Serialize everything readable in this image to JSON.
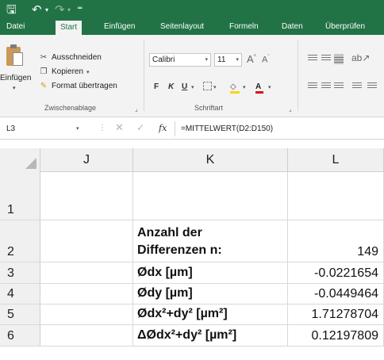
{
  "quick_access": {
    "save_icon": "save-icon",
    "undo_icon": "undo-icon",
    "redo_icon": "redo-icon",
    "customize_icon": "customize-qat-icon"
  },
  "ribbon_tabs": [
    {
      "label": "Datei"
    },
    {
      "label": "Start"
    },
    {
      "label": "Einfügen"
    },
    {
      "label": "Seitenlayout"
    },
    {
      "label": "Formeln"
    },
    {
      "label": "Daten"
    },
    {
      "label": "Überprüfen"
    }
  ],
  "ribbon": {
    "clipboard": {
      "paste_label": "Einfügen",
      "cut_label": "Ausschneiden",
      "copy_label": "Kopieren",
      "format_painter_label": "Format übertragen",
      "group_label": "Zwischenablage"
    },
    "font": {
      "font_name": "Calibri",
      "font_size": "11",
      "bold_label": "F",
      "italic_label": "K",
      "underline_label": "U",
      "fill_color": "#f5d60a",
      "font_color": "#e01010",
      "font_color_label": "A",
      "group_label": "Schriftart"
    }
  },
  "formula_bar": {
    "name_box": "L3",
    "function_label": "fx",
    "formula": "=MITTELWERT(D2:D150)"
  },
  "columns": [
    "J",
    "K",
    "L"
  ],
  "rows": [
    {
      "number": "1",
      "label_line1": "",
      "label_line2": "",
      "value": ""
    },
    {
      "number": "2",
      "label_line1": "Anzahl der",
      "label_line2": "Differenzen n:",
      "value": "149"
    },
    {
      "number": "3",
      "label_line1": "Ødx [µm]",
      "label_line2": "",
      "value": "-0.0221654"
    },
    {
      "number": "4",
      "label_line1": "Ødy [µm]",
      "label_line2": "",
      "value": "-0.0449464"
    },
    {
      "number": "5",
      "label_line1": "Ødx²+dy² [µm²]",
      "label_line2": "",
      "value": "1.71278704"
    },
    {
      "number": "6",
      "label_line1": "ΔØdx²+dy² [µm²]",
      "label_line2": "",
      "value": "0.12197809"
    }
  ],
  "colors": {
    "accent": "#217346"
  }
}
